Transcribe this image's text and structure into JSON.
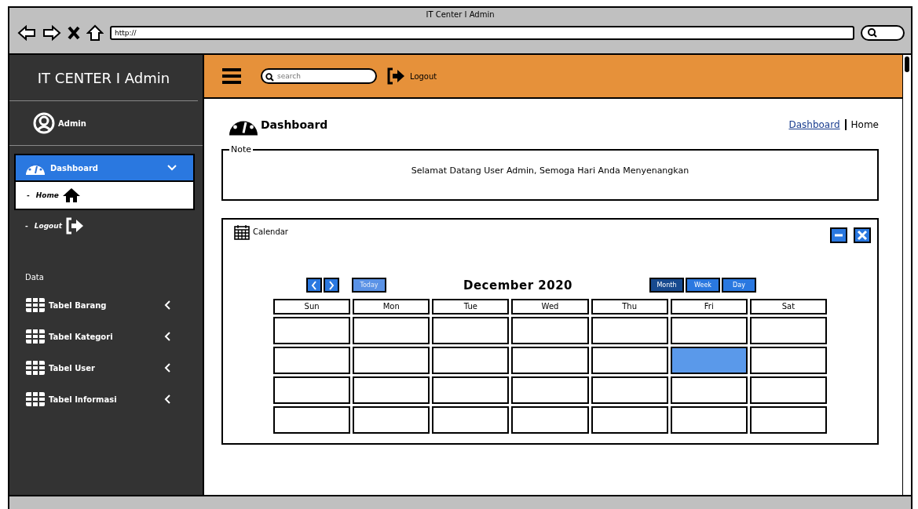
{
  "window": {
    "title": "IT Center I Admin",
    "url": "http://"
  },
  "sidebar": {
    "brand": "IT CENTER I Admin",
    "user": "Admin",
    "menu": [
      {
        "label": "Dashboard",
        "kind": "group",
        "selected": true,
        "expanded": true,
        "children": [
          {
            "bullet": "-",
            "label": "Home",
            "kind": "home"
          }
        ]
      },
      {
        "bullet": "-",
        "label": "Logout",
        "kind": "logout"
      }
    ],
    "section": "Data",
    "items": [
      {
        "label": "Tabel Barang",
        "expanded": false
      },
      {
        "label": "Tabel Kategori",
        "expanded": false
      },
      {
        "label": "Tabel User",
        "expanded": false
      },
      {
        "label": "Tabel Informasi",
        "expanded": false
      }
    ]
  },
  "topbar": {
    "search": {
      "placeholder": "search"
    },
    "logout": "Logout"
  },
  "page": {
    "title": "Dashboard",
    "breadcrumb": [
      {
        "label": "Dashboard",
        "kind": "link"
      },
      {
        "label": "Home",
        "kind": "current"
      }
    ]
  },
  "note": {
    "legend": "Note",
    "text": "Selamat Datang User Admin, Semoga Hari Anda Menyenangkan"
  },
  "calendar": {
    "title": "Calendar",
    "today": {
      "label": "Today",
      "disabled": true
    },
    "month": "December 2020",
    "views": [
      {
        "label": "Month",
        "selected": true
      },
      {
        "label": "Week",
        "selected": false
      },
      {
        "label": "Day",
        "selected": false
      }
    ],
    "days": [
      "Sun",
      "Mon",
      "Tue",
      "Wed",
      "Thu",
      "Fri",
      "Sat"
    ],
    "weeks": [
      {
        "cells": [
          {
            "selected": false
          },
          {
            "selected": false
          },
          {
            "selected": false
          },
          {
            "selected": false
          },
          {
            "selected": false
          },
          {
            "selected": false
          },
          {
            "selected": false
          }
        ]
      },
      {
        "cells": [
          {
            "selected": false
          },
          {
            "selected": false
          },
          {
            "selected": false
          },
          {
            "selected": false
          },
          {
            "selected": false
          },
          {
            "selected": true
          },
          {
            "selected": false
          }
        ]
      },
      {
        "cells": [
          {
            "selected": false
          },
          {
            "selected": false
          },
          {
            "selected": false
          },
          {
            "selected": false
          },
          {
            "selected": false
          },
          {
            "selected": false
          },
          {
            "selected": false
          }
        ]
      },
      {
        "cells": [
          {
            "selected": false
          },
          {
            "selected": false
          },
          {
            "selected": false
          },
          {
            "selected": false
          },
          {
            "selected": false
          },
          {
            "selected": false
          },
          {
            "selected": false
          }
        ]
      }
    ]
  }
}
